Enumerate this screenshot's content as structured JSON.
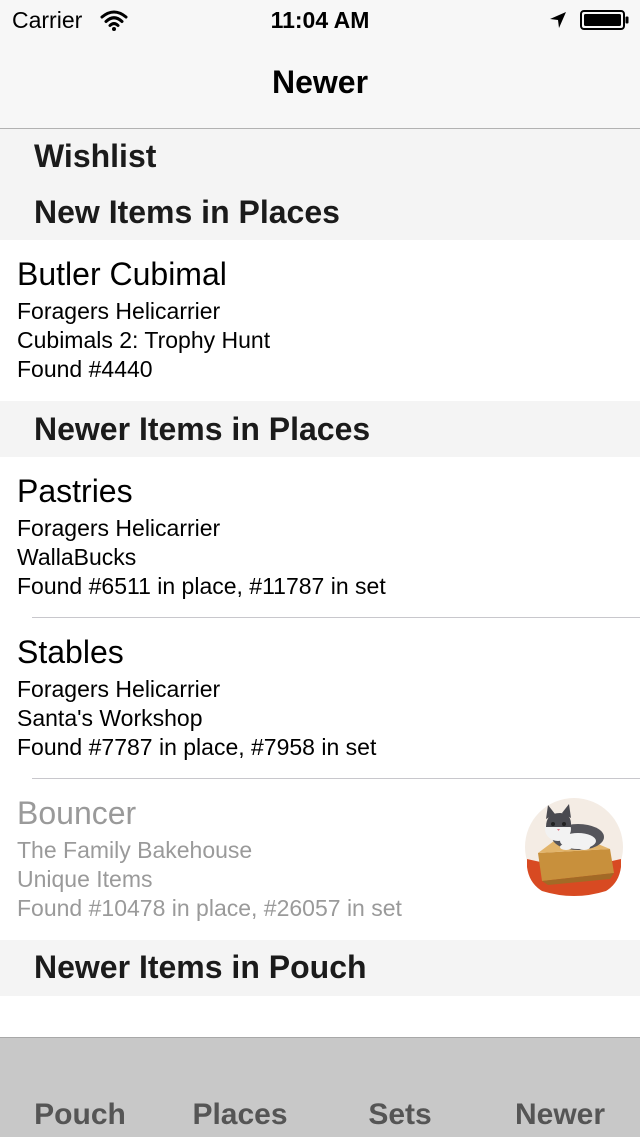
{
  "status_bar": {
    "carrier": "Carrier",
    "time": "11:04 AM"
  },
  "nav": {
    "title": "Newer"
  },
  "sections": {
    "wishlist": "Wishlist",
    "new_items": "New Items in Places",
    "newer_items": "Newer Items in Places",
    "newer_pouch": "Newer Items in Pouch"
  },
  "items": [
    {
      "title": "Butler Cubimal",
      "place": "Foragers Helicarrier",
      "set": "Cubimals 2: Trophy Hunt",
      "found": "Found #4440"
    },
    {
      "title": "Pastries",
      "place": "Foragers Helicarrier",
      "set": "WallaBucks",
      "found": "Found #6511 in place, #11787 in set"
    },
    {
      "title": "Stables",
      "place": "Foragers Helicarrier",
      "set": "Santa's Workshop",
      "found": "Found #7787 in place, #7958 in set"
    },
    {
      "title": "Bouncer",
      "place": "The Family Bakehouse",
      "set": "Unique Items",
      "found": "Found #10478 in place, #26057 in set",
      "thumbnail": "cat-in-box-icon"
    }
  ],
  "tabs": [
    "Pouch",
    "Places",
    "Sets",
    "Newer"
  ],
  "colors": {
    "bar_background": "#f7f7f7",
    "section_background": "#f4f4f4",
    "tab_bar_background": "#c8c8c8",
    "dimmed_text": "#9a9a9a"
  }
}
